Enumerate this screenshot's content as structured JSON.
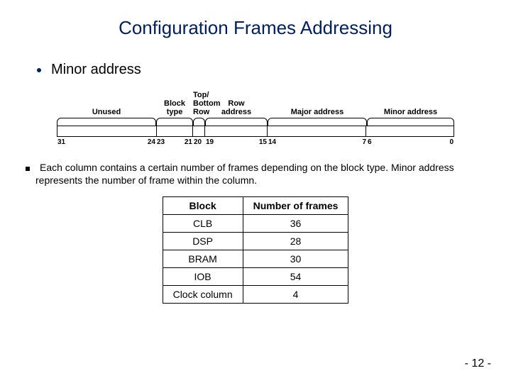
{
  "title": "Configuration Frames Addressing",
  "main_bullet": "Minor address",
  "bitfield": {
    "fields": [
      {
        "name": "Unused",
        "hi": "31",
        "lo": "24"
      },
      {
        "name": "Block type",
        "hi": "23",
        "lo": "21"
      },
      {
        "name": "Top/\nBottom\nRow",
        "hi": "20",
        "lo": ""
      },
      {
        "name": "Row\naddress",
        "hi": "19",
        "lo": "15"
      },
      {
        "name": "Major address",
        "hi": "14",
        "lo": "7"
      },
      {
        "name": "Minor address",
        "hi": "6",
        "lo": "0"
      }
    ]
  },
  "paragraph": "Each column contains a certain number of frames depending on the block type. Minor address represents the number of frame within the column.",
  "frames_table": {
    "headers": {
      "col1": "Block",
      "col2": "Number of frames"
    },
    "rows": [
      {
        "block": "CLB",
        "frames": "36"
      },
      {
        "block": "DSP",
        "frames": "28"
      },
      {
        "block": "BRAM",
        "frames": "30"
      },
      {
        "block": "IOB",
        "frames": "54"
      },
      {
        "block": "Clock column",
        "frames": "4"
      }
    ]
  },
  "slide_number": "- 12 -"
}
